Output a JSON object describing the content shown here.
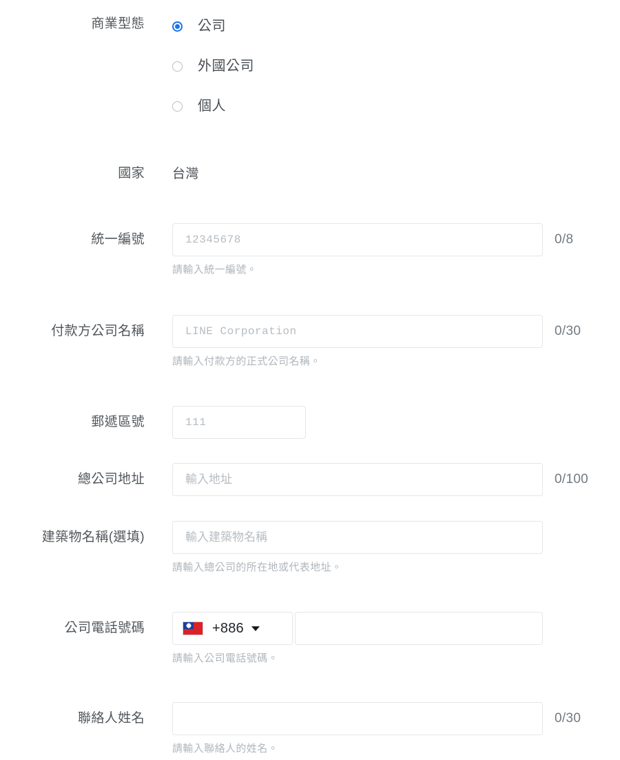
{
  "theme": {
    "accent": "#1a73e8",
    "label_color": "#52575c",
    "helper_color": "#b0b6bc",
    "border_color": "#e3e6e8",
    "placeholder_color": "#b6bcc2",
    "counter_color": "#707980",
    "background": "#ffffff"
  },
  "form": {
    "business_type": {
      "label": "商業型態",
      "options": [
        {
          "label": "公司",
          "selected": true
        },
        {
          "label": "外國公司",
          "selected": false
        },
        {
          "label": "個人",
          "selected": false
        }
      ]
    },
    "country": {
      "label": "國家",
      "value": "台灣"
    },
    "tax_id": {
      "label": "統一編號",
      "value": "",
      "placeholder": "12345678",
      "counter": "0/8",
      "helper": "請輸入統一編號。"
    },
    "company_name": {
      "label": "付款方公司名稱",
      "value": "",
      "placeholder": "LINE Corporation",
      "counter": "0/30",
      "helper": "請輸入付款方的正式公司名稱。"
    },
    "postal_code": {
      "label": "郵遞區號",
      "value": "",
      "placeholder": "111"
    },
    "head_office_address": {
      "label": "總公司地址",
      "value": "",
      "placeholder": "輸入地址",
      "counter": "0/100"
    },
    "building_name": {
      "label": "建築物名稱(選填)",
      "value": "",
      "placeholder": "輸入建築物名稱",
      "helper": "請輸入總公司的所在地或代表地址。"
    },
    "company_phone": {
      "label": "公司電話號碼",
      "country_code": "+886",
      "flag_icon": "taiwan-flag-icon",
      "dropdown_icon": "chevron-down-icon",
      "value": "",
      "placeholder": "",
      "helper": "請輸入公司電話號碼。"
    },
    "contact_name": {
      "label": "聯絡人姓名",
      "value": "",
      "placeholder": "",
      "counter": "0/30",
      "helper": "請輸入聯絡人的姓名。"
    }
  }
}
